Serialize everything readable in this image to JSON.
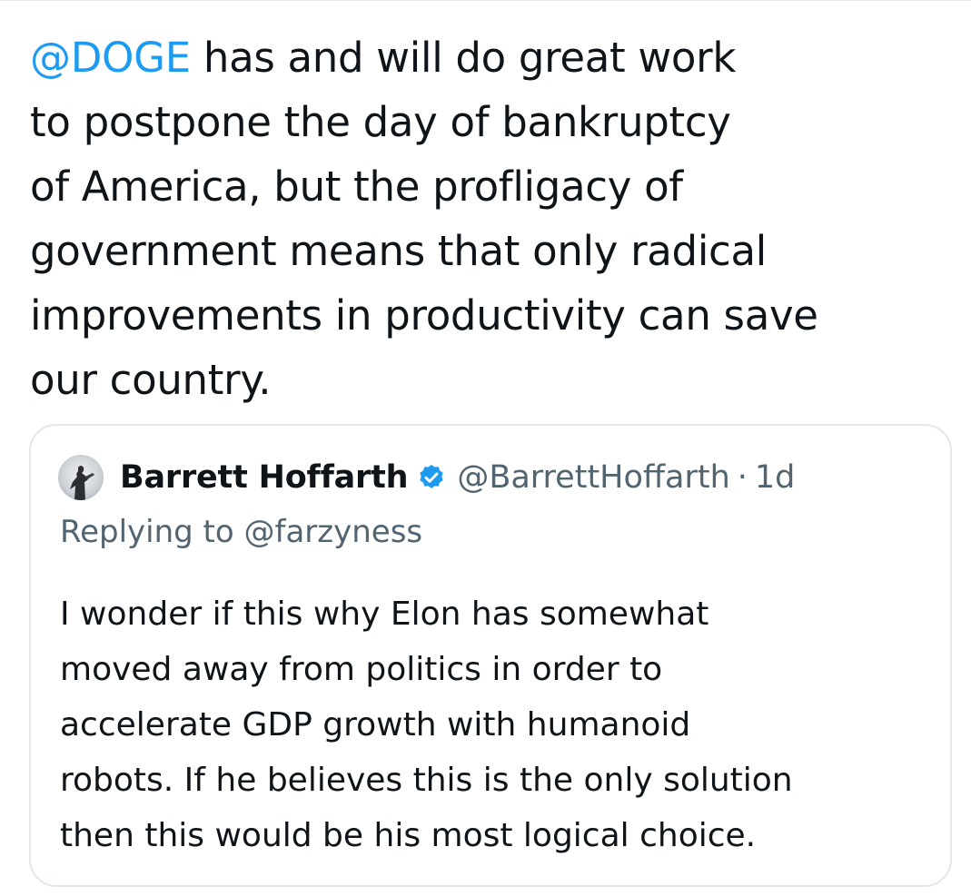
{
  "tweet": {
    "mention": "@DOGE",
    "lines": [
      " has and will do great work",
      "to postpone the day of bankruptcy",
      "of America, but the profligacy of",
      "government means that only radical",
      "improvements in productivity can save",
      "our country."
    ]
  },
  "quote": {
    "display_name": "Barrett Hoffarth",
    "verified_icon": "verified-badge-icon",
    "handle": "@BarrettHoffarth",
    "separator": "·",
    "time": "1d",
    "replying_to_prefix": "Replying to ",
    "replying_to_handle": "@farzyness",
    "lines": [
      "I wonder if this why Elon has somewhat",
      "moved away from politics in order to",
      "accelerate GDP growth with humanoid",
      "robots. If he believes this is the only solution",
      "then this would be his most logical choice."
    ]
  },
  "colors": {
    "accent": "#1d9bf0",
    "text": "#0f1419",
    "secondary": "#536471",
    "border": "#e3e7ea"
  }
}
